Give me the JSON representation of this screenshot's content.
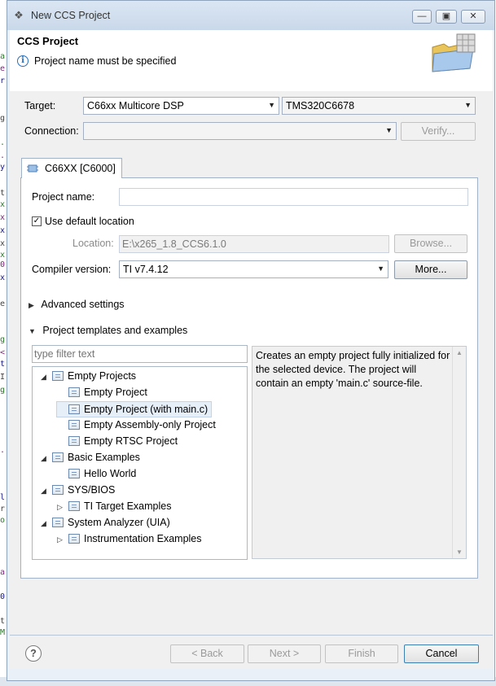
{
  "window": {
    "title": "New CCS Project",
    "controls": [
      "minimize",
      "maximize",
      "close"
    ]
  },
  "header": {
    "title": "CCS Project",
    "message": "Project name must be specified"
  },
  "target": {
    "label": "Target:",
    "family": "C66xx Multicore DSP",
    "device": "TMS320C6678"
  },
  "connection": {
    "label": "Connection:",
    "value": "",
    "verify_label": "Verify..."
  },
  "tab": {
    "label": "C66XX [C6000]"
  },
  "project_name": {
    "label": "Project name:",
    "value": ""
  },
  "use_default_location": {
    "label": "Use default location",
    "checked": true
  },
  "location": {
    "label": "Location:",
    "value": "E:\\x265_1.8_CCS6.1.0",
    "browse_label": "Browse..."
  },
  "compiler": {
    "label": "Compiler version:",
    "value": "TI v7.4.12",
    "more_label": "More..."
  },
  "advanced_settings": {
    "label": "Advanced settings",
    "expanded": false
  },
  "templates": {
    "label": "Project templates and examples",
    "expanded": true,
    "filter_placeholder": "type filter text",
    "description": "Creates an empty project fully initialized for the selected device. The project will contain an empty 'main.c' source-file.",
    "tree": [
      {
        "label": "Empty Projects",
        "level": 0,
        "expander": "open"
      },
      {
        "label": "Empty Project",
        "level": 1,
        "expander": "none"
      },
      {
        "label": "Empty Project (with main.c)",
        "level": 1,
        "expander": "none",
        "selected": true
      },
      {
        "label": "Empty Assembly-only Project",
        "level": 1,
        "expander": "none"
      },
      {
        "label": "Empty RTSC Project",
        "level": 1,
        "expander": "none"
      },
      {
        "label": "Basic Examples",
        "level": 0,
        "expander": "open"
      },
      {
        "label": "Hello World",
        "level": 1,
        "expander": "none"
      },
      {
        "label": "SYS/BIOS",
        "level": 0,
        "expander": "open"
      },
      {
        "label": "TI Target Examples",
        "level": 1,
        "expander": "closed"
      },
      {
        "label": "System Analyzer (UIA)",
        "level": 0,
        "expander": "open"
      },
      {
        "label": "Instrumentation Examples",
        "level": 1,
        "expander": "closed"
      }
    ]
  },
  "footer": {
    "help_icon": "help-icon",
    "back_label": "< Back",
    "next_label": "Next >",
    "finish_label": "Finish",
    "cancel_label": "Cancel"
  },
  "background_editor_chars": [
    "a",
    "e",
    "r",
    "g",
    ".",
    ".",
    "y",
    "t",
    "x",
    "x",
    "x",
    "x",
    "x",
    "0",
    "x",
    "e",
    "g",
    "<",
    "t",
    "I",
    "g",
    ".",
    "l",
    "r",
    "o",
    "a",
    "0",
    "t",
    "M"
  ],
  "colors": {
    "window_bg": "#eaf0f8",
    "accent_border": "#9fb2c8",
    "selection": "#e6eef8"
  }
}
